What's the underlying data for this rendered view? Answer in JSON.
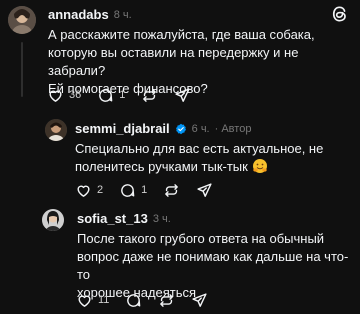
{
  "comments": [
    {
      "username": "annadabs",
      "time": "8 ч.",
      "verified": false,
      "author_tag": "",
      "lines": [
        "А расскажите пожалуйста, где ваша собака,",
        "которую вы оставили на передержку и не забрали?",
        "Ей помогаете финансово?"
      ],
      "likes": "36",
      "replies": "1",
      "reposts": "",
      "icons": [
        "heart-icon",
        "comment-icon",
        "repost-icon",
        "share-icon"
      ]
    },
    {
      "username": "semmi_djabrail",
      "time": "6 ч.",
      "verified": true,
      "author_tag": "· Автор",
      "lines": [
        "Специально для вас есть актуальное, не",
        "поленитесь ручками тык-тык"
      ],
      "emoji": "hugging-face-emoji",
      "likes": "2",
      "replies": "1",
      "reposts": ""
    },
    {
      "username": "sofia_st_13",
      "time": "3 ч.",
      "verified": false,
      "author_tag": "",
      "lines": [
        "После такого грубого ответа на обычный",
        "вопрос даже не понимаю как дальше на что-то",
        "хорошее надеяться"
      ],
      "likes": "11",
      "replies": "",
      "reposts": ""
    }
  ],
  "colors": {
    "background": "#101010",
    "text": "#f3f5f7",
    "muted": "#777777",
    "verified": "#0095f6"
  }
}
